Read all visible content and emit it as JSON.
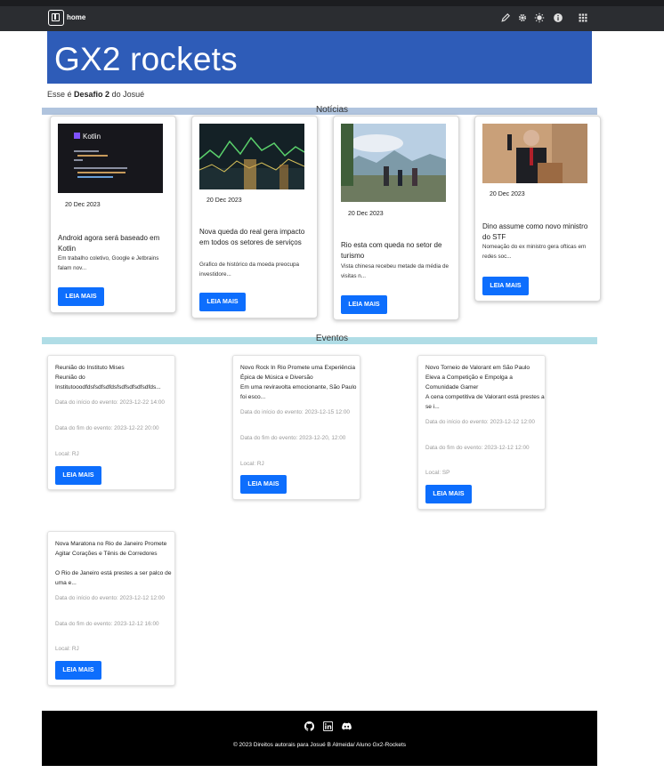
{
  "navbar": {
    "brand": "home",
    "icons": [
      "pencil-icon",
      "gear-icon",
      "sun-icon",
      "info-icon",
      "apps-grid-icon"
    ]
  },
  "hero": {
    "title": "GX2 rockets",
    "subtitle_prefix": "Esse é",
    "subtitle_bold": "Desafio 2",
    "subtitle_suffix": "do Josué"
  },
  "news_section": {
    "title": "Notícias",
    "bar_color": "#b0c4de",
    "cards": [
      {
        "date": "20 Dec 2023",
        "title": "Android agora será baseado em Kotlin",
        "desc": "Em trabalho coletivo, Google e Jetbrains falam nov...",
        "button": "LEIA MAIS"
      },
      {
        "date": "20 Dec 2023",
        "title": "Nova queda do real gera impacto em todos os setores de serviços",
        "desc": "Grafico de histórico da moeda preocupa investidore...",
        "button": "LEIA MAIS"
      },
      {
        "date": "20 Dec 2023",
        "title": "Rio esta com queda no setor de turismo",
        "desc": "Vista chinesa recebeu metade da média de visitas n...",
        "button": "LEIA MAIS"
      },
      {
        "date": "20 Dec 2023",
        "title": "Dino assume como novo ministro do STF",
        "desc": "Nomeação do ex ministro gera ofticas em redes soc...",
        "button": "LEIA MAIS"
      }
    ]
  },
  "events_section": {
    "title": "Eventos",
    "bar_color": "#b0dde6",
    "start_label": "Data do início do evento:",
    "end_label": "Data do fim do evento:",
    "local_label": "Local:",
    "cards": [
      {
        "title": "Reunião do Instituto Mises",
        "desc": "Reunião do Institutooodfdsfsdfsdfdsfsdfsdfsdfsdfds...",
        "start": "2023-12-22 14:00",
        "end": "2023-12-22 20:00",
        "local": "RJ",
        "button": "LEIA MAIS"
      },
      {
        "title": "Novo Rock In Rio Promete uma Experiência Épica de Música e Diversão",
        "desc": "Em uma reviravolta emocionante, São Paulo foi esco...",
        "start": "2023-12-15 12:00",
        "end": "2023-12-20, 12:00",
        "local": "RJ",
        "button": "LEIA MAIS"
      },
      {
        "title": "Novo Torneio de Valorant em São Paulo Eleva a Competição e Empolga a Comunidade Gamer",
        "desc": "A cena competitiva de Valorant está prestes a se i...",
        "start": "2023-12-12 12:00",
        "end": "2023-12-12 12:00",
        "local": "SP",
        "button": "LEIA MAIS"
      },
      {
        "title": "Nova Maratona no Rio de Janeiro Promete Agitar Corações e Tênis de Corredores",
        "desc": "O Rio de Janeiro está prestes a ser palco de uma e...",
        "start": "2023-12-12 12:00",
        "end": "2023-12-12 16:00",
        "local": "RJ",
        "button": "LEIA MAIS"
      }
    ]
  },
  "footer": {
    "icons": [
      "github-icon",
      "linkedin-icon",
      "discord-icon"
    ],
    "copyright": "© 2023 Direitos autorais para Josué B Almeida/ Aluno Gx2-Rockets"
  }
}
